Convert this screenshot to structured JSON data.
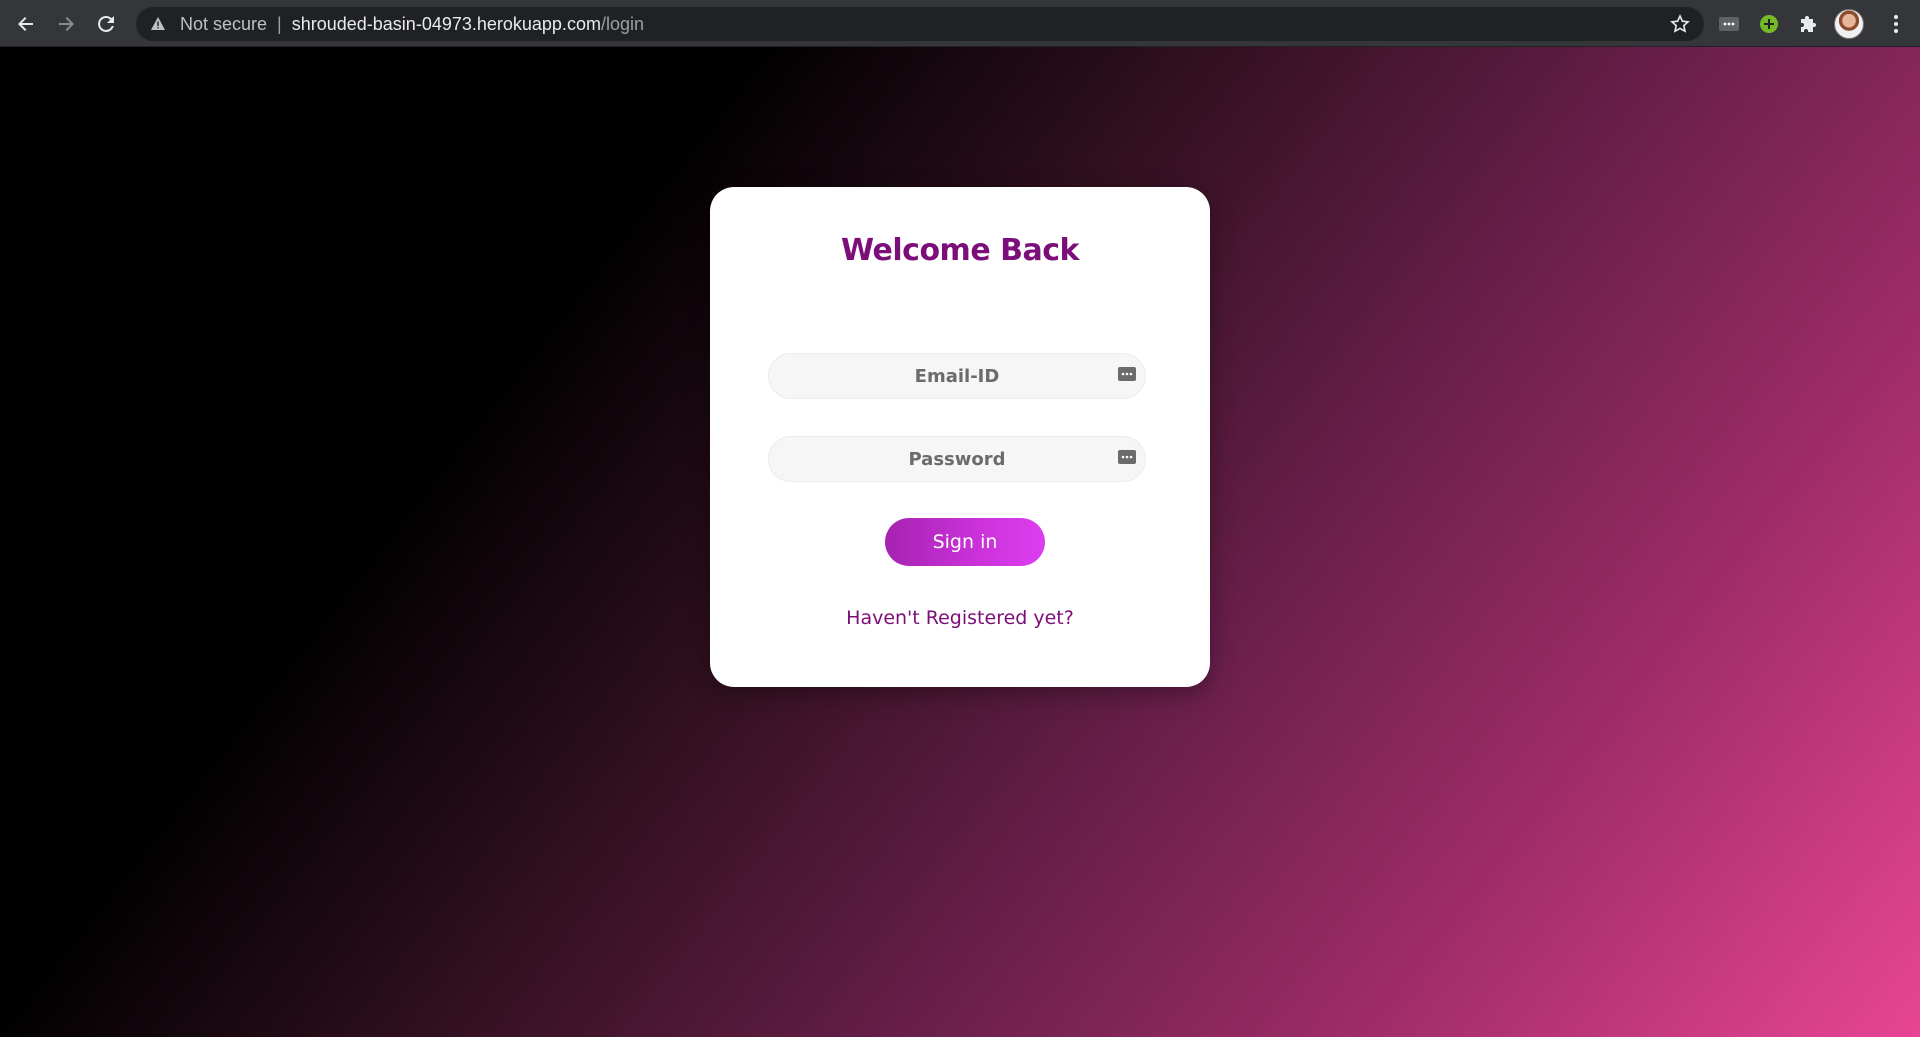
{
  "browser": {
    "security_label": "Not secure",
    "url_host": "shrouded-basin-04973.herokuapp.com",
    "url_path": "/login",
    "icons": [
      "back-icon",
      "forward-icon",
      "reload-icon",
      "warning-icon",
      "bookmark-star-icon",
      "extension-dots-icon",
      "extension-plus-icon",
      "puzzle-icon",
      "profile-avatar",
      "menu-kebab-icon"
    ]
  },
  "login": {
    "title": "Welcome Back",
    "email_placeholder": "Email-ID",
    "email_value": "",
    "password_placeholder": "Password",
    "password_value": "",
    "signin_label": "Sign in",
    "register_link": "Haven't Registered yet?"
  },
  "colors": {
    "accent": "#7c0e79",
    "button_start": "#a623b0",
    "button_end": "#dd3ef0",
    "background_end": "#e84594"
  }
}
